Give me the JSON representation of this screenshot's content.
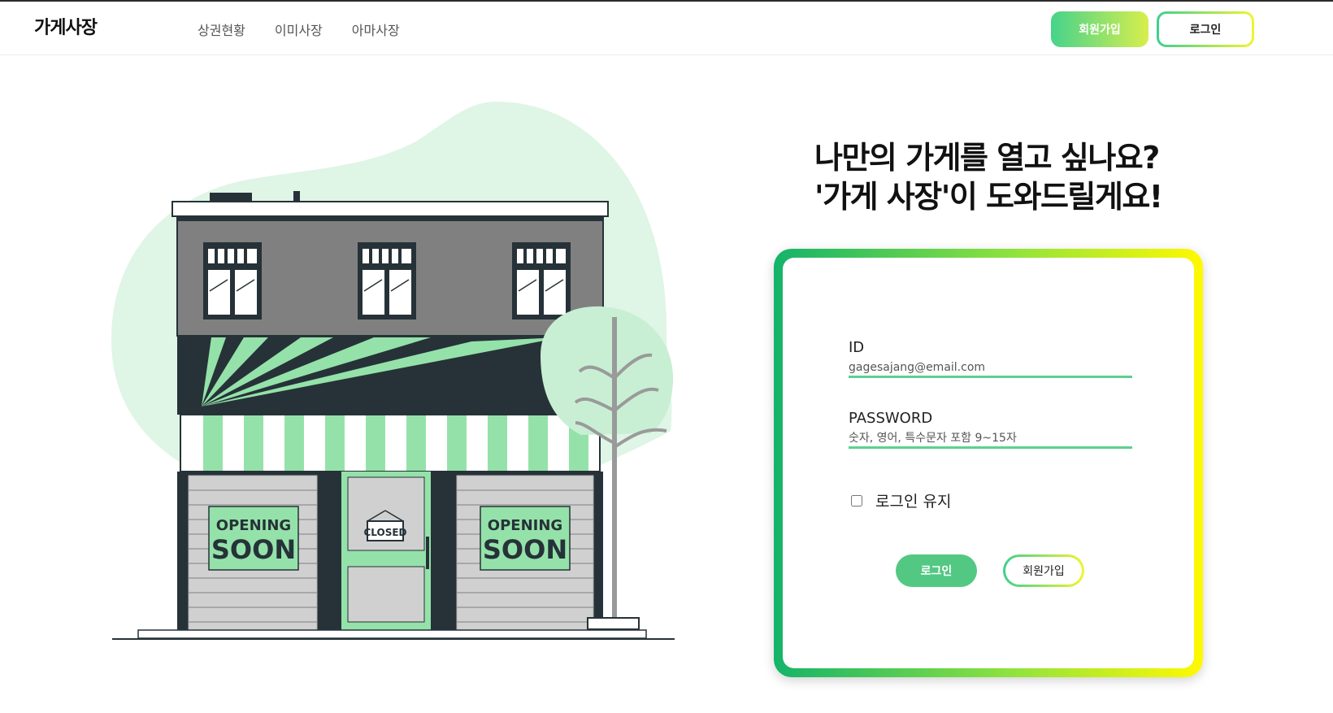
{
  "header": {
    "logo": "가게사장",
    "nav": [
      "상권현황",
      "이미사장",
      "아마사장"
    ],
    "signup_label": "회원가입",
    "login_label": "로그인"
  },
  "illustration": {
    "signs": [
      {
        "line1": "OPENING",
        "line2": "SOON"
      },
      {
        "line1": "OPENING",
        "line2": "SOON"
      }
    ],
    "door_sign": "CLOSED"
  },
  "hero": {
    "line1": "나만의 가게를 열고 싶나요?",
    "line2": "'가게 사장'이 도와드릴게요!"
  },
  "login_form": {
    "id_label": "ID",
    "id_placeholder": "gagesajang@email.com",
    "password_label": "PASSWORD",
    "password_placeholder": "숫자, 영어, 특수문자 포함 9~15자",
    "keep_login_label": "로그인 유지",
    "keep_login_checked": false,
    "login_button": "로그인",
    "signup_button": "회원가입"
  },
  "colors": {
    "accent_green": "#53c882",
    "gradient_start": "#14b36a",
    "gradient_end": "#fff900",
    "blob": "#dff5e6",
    "stripe_green": "#94e2a9",
    "building_dark": "#263238"
  }
}
